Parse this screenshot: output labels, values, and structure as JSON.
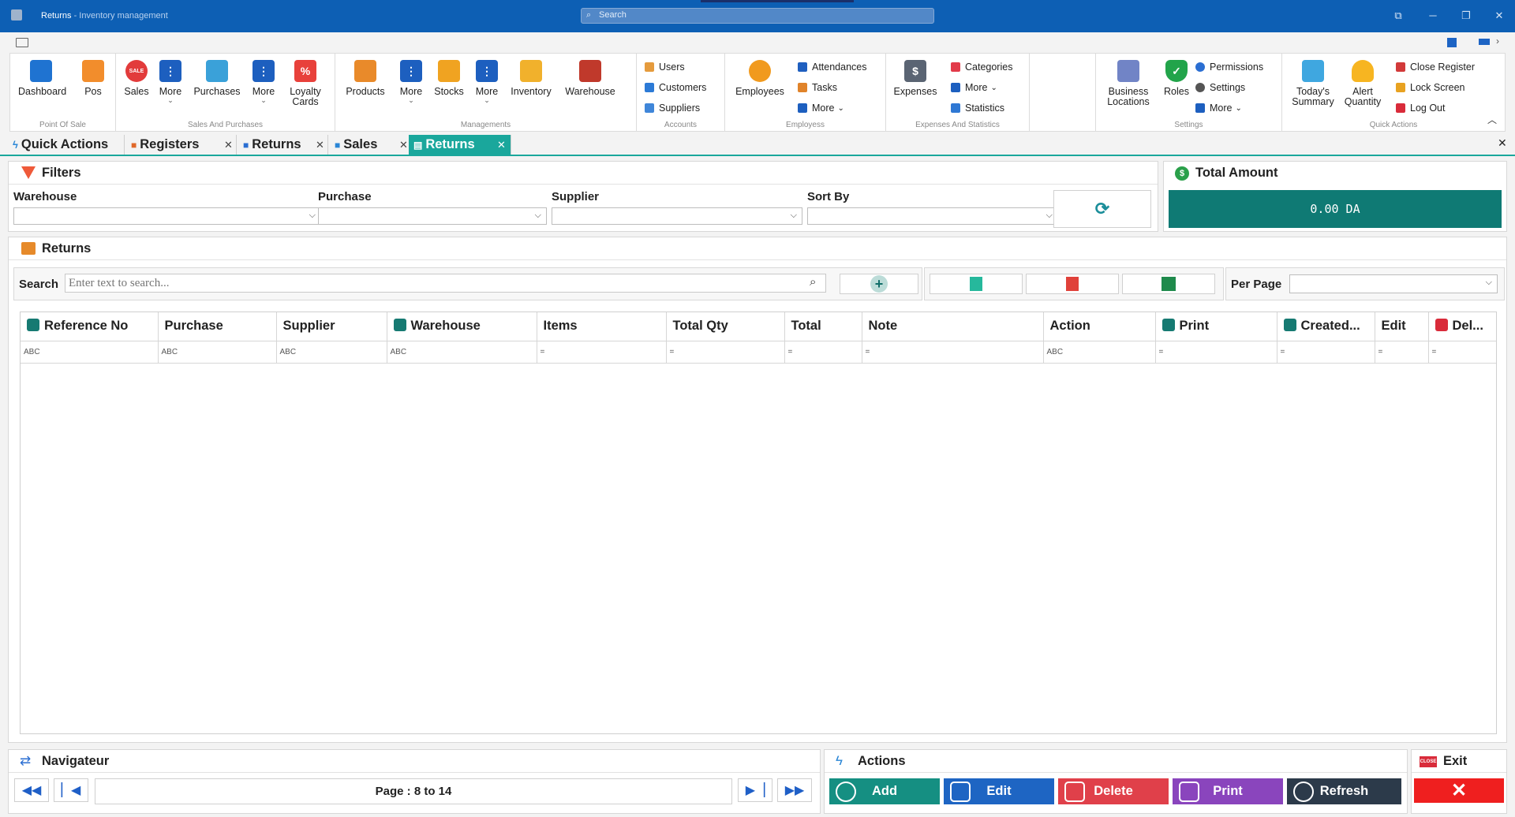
{
  "window": {
    "title": "Returns",
    "subtitle": " - Inventory management",
    "search_placeholder": "Search"
  },
  "ribbon": {
    "groups": [
      {
        "label": "Point Of Sale"
      },
      {
        "label": "Sales And Purchases"
      },
      {
        "label": "Managements"
      },
      {
        "label": "Accounts"
      },
      {
        "label": "Employess"
      },
      {
        "label": "Expenses And Statistics"
      },
      {
        "label": "Settings"
      },
      {
        "label": "Quick Actions"
      }
    ],
    "buttons": {
      "dashboard": "Dashboard",
      "pos": "Pos",
      "sales": "Sales",
      "more1": "More",
      "purchases": "Purchases",
      "more2": "More",
      "loyalty": "Loyalty Cards",
      "products": "Products",
      "more3": "More",
      "stocks": "Stocks",
      "more4": "More",
      "inventory": "Inventory",
      "warehouse": "Warehouse",
      "users": "Users",
      "customers": "Customers",
      "suppliers": "Suppliers",
      "employees": "Employees",
      "attendances": "Attendances",
      "tasks": "Tasks",
      "more5": "More",
      "expenses": "Expenses",
      "categories": "Categories",
      "more6": "More",
      "statistics": "Statistics",
      "business": "Business Locations",
      "roles": "Roles",
      "permissions": "Permissions",
      "settings": "Settings",
      "more7": "More",
      "today": "Today's Summary",
      "alert": "Alert Quantity",
      "close_register": "Close Register",
      "lock_screen": "Lock Screen",
      "log_out": "Log Out"
    }
  },
  "tabs": [
    {
      "label": "Quick Actions",
      "closable": false
    },
    {
      "label": "Registers",
      "closable": true
    },
    {
      "label": "Returns",
      "closable": true
    },
    {
      "label": "Sales",
      "closable": true
    },
    {
      "label": "Returns",
      "closable": true,
      "active": true
    }
  ],
  "filters": {
    "title": "Filters",
    "warehouse": "Warehouse",
    "purchase": "Purchase",
    "supplier": "Supplier",
    "sort_by": "Sort By"
  },
  "total": {
    "title": "Total Amount",
    "value": "0.00 DA"
  },
  "returns": {
    "title": "Returns",
    "search_label": "Search",
    "search_placeholder": "Enter text to search...",
    "per_page": "Per Page"
  },
  "table": {
    "columns": [
      "Reference No",
      "Purchase",
      "Supplier",
      "Warehouse",
      "Items",
      "Total Qty",
      "Total",
      "Note",
      "Action",
      "Print",
      "Created...",
      "Edit",
      "Del..."
    ],
    "filter_row": [
      "ABC",
      "ABC",
      "ABC",
      "ABC",
      "=",
      "=",
      "=",
      "=",
      "ABC",
      "=",
      "=",
      "=",
      "="
    ]
  },
  "navigator": {
    "title": "Navigateur",
    "page": "Page : 8 to 14"
  },
  "actions": {
    "title": "Actions",
    "add": "Add",
    "edit": "Edit",
    "delete": "Delete",
    "print": "Print",
    "refresh": "Refresh"
  },
  "exit": {
    "title": "Exit",
    "badge": "CLOSE"
  },
  "colors": {
    "titlebar": "#0d5fb4",
    "accent": "#1aa79c",
    "total_bg": "#0f7a74",
    "add": "#158f82",
    "edit": "#1e65c3",
    "delete": "#e0404a",
    "print": "#8a45bd",
    "refresh": "#2c3a4a",
    "exit": "#ef1f1f"
  }
}
